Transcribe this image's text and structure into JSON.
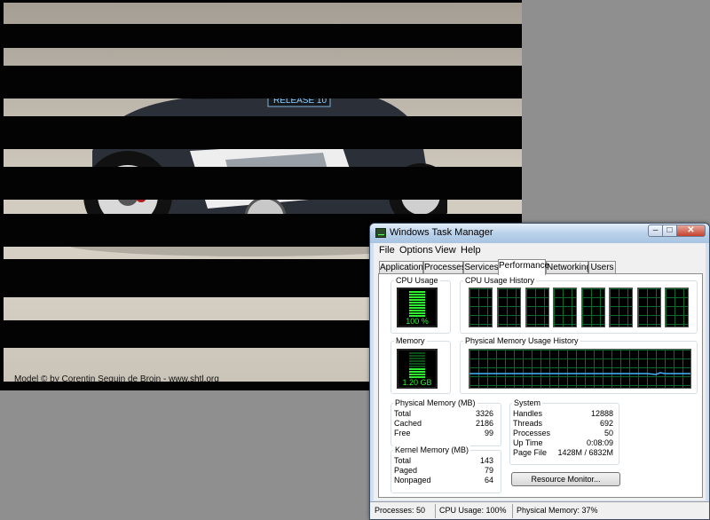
{
  "render_window": {
    "credit": "Model © by Corentin Seguin de Broin - www.shtl.org",
    "bike_plate_text": "RELEASE 10"
  },
  "task_manager": {
    "title": "Windows Task Manager",
    "menu": [
      "File",
      "Options",
      "View",
      "Help"
    ],
    "tabs": [
      "Applications",
      "Processes",
      "Services",
      "Performance",
      "Networking",
      "Users"
    ],
    "active_tab": "Performance",
    "cpu_usage": {
      "label": "CPU Usage",
      "value": "100 %",
      "level": 1.0
    },
    "cpu_history": {
      "label": "CPU Usage History",
      "cores": 8,
      "levels": [
        1,
        1,
        1,
        1,
        1,
        1,
        1,
        1
      ]
    },
    "memory": {
      "label": "Memory",
      "value": "1.20 GB",
      "level": 0.37
    },
    "physical_memory_history": {
      "label": "Physical Memory Usage History"
    },
    "physical_memory": {
      "label": "Physical Memory (MB)",
      "rows": [
        {
          "label": "Total",
          "value": "3326"
        },
        {
          "label": "Cached",
          "value": "2186"
        },
        {
          "label": "Free",
          "value": "99"
        }
      ]
    },
    "kernel_memory": {
      "label": "Kernel Memory (MB)",
      "rows": [
        {
          "label": "Total",
          "value": "143"
        },
        {
          "label": "Paged",
          "value": "79"
        },
        {
          "label": "Nonpaged",
          "value": "64"
        }
      ]
    },
    "system": {
      "label": "System",
      "rows": [
        {
          "label": "Handles",
          "value": "12888"
        },
        {
          "label": "Threads",
          "value": "692"
        },
        {
          "label": "Processes",
          "value": "50"
        },
        {
          "label": "Up Time",
          "value": "0:08:09"
        },
        {
          "label": "Page File",
          "value": "1428M / 6832M"
        }
      ]
    },
    "resource_monitor_button": "Resource Monitor...",
    "status": {
      "processes": "Processes: 50",
      "cpu": "CPU Usage: 100%",
      "memory": "Physical Memory: 37%"
    },
    "colors": {
      "meter_green": "#2ff12f",
      "grid_green": "#0b6b2b",
      "memory_line": "#3fb7ff"
    }
  }
}
